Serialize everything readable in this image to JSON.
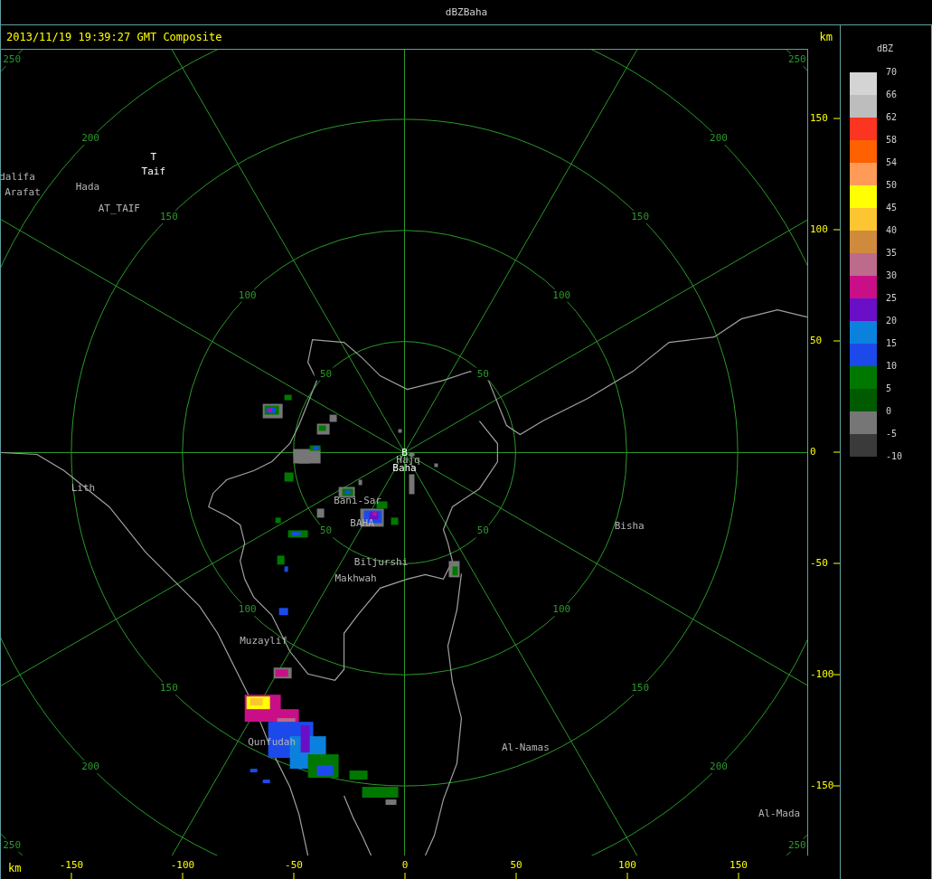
{
  "window": {
    "title": "dBZBaha"
  },
  "header": {
    "timestamp": "2013/11/19 19:39:27 GMT Composite",
    "unit": "km"
  },
  "range_rings": [
    {
      "labels": [
        "50",
        "50",
        "50",
        "50"
      ]
    },
    {
      "labels": [
        "100",
        "100",
        "100",
        "100"
      ]
    },
    {
      "labels": [
        "150",
        "150",
        "150",
        "150"
      ]
    },
    {
      "labels": [
        "200",
        "200",
        "200",
        "200"
      ]
    },
    {
      "labels": [
        "250",
        "250",
        "250",
        "250"
      ]
    }
  ],
  "places": [
    {
      "kind": "site",
      "name": "T"
    },
    {
      "kind": "site",
      "name": "Taif"
    },
    {
      "kind": "town",
      "name": "dalifa"
    },
    {
      "kind": "town",
      "name": "Arafat"
    },
    {
      "kind": "town",
      "name": "Hada"
    },
    {
      "kind": "town",
      "name": "AT_TAIF"
    },
    {
      "kind": "town",
      "name": "Lith"
    },
    {
      "kind": "site",
      "name": "B"
    },
    {
      "kind": "town",
      "name": "Hajq"
    },
    {
      "kind": "site",
      "name": "Baha"
    },
    {
      "kind": "town",
      "name": "Bani-Sar"
    },
    {
      "kind": "town",
      "name": "BAHA"
    },
    {
      "kind": "town",
      "name": "Biljurshi"
    },
    {
      "kind": "town",
      "name": "Makhwah"
    },
    {
      "kind": "town",
      "name": "Bisha"
    },
    {
      "kind": "town",
      "name": "Muzaylif"
    },
    {
      "kind": "town",
      "name": "Qunfudah"
    },
    {
      "kind": "town",
      "name": "Al-Namas"
    },
    {
      "kind": "town",
      "name": "Al-Mada"
    }
  ],
  "y_axis": {
    "ticks": [
      "150",
      "100",
      "50",
      "0",
      "-50",
      "-100",
      "-150"
    ]
  },
  "x_axis": {
    "unit": "km",
    "ticks": [
      "-150",
      "-100",
      "-50",
      "0",
      "50",
      "100",
      "150"
    ]
  },
  "legend": {
    "title": "dBZ",
    "bands": [
      {
        "label": "70",
        "color": "#d4d4d4"
      },
      {
        "label": "66",
        "color": "#bdbdbd"
      },
      {
        "label": "62",
        "color": "#fc3522"
      },
      {
        "label": "58",
        "color": "#ff6000"
      },
      {
        "label": "54",
        "color": "#ff9a58"
      },
      {
        "label": "50",
        "color": "#ffff00"
      },
      {
        "label": "45",
        "color": "#fcc531"
      },
      {
        "label": "40",
        "color": "#d08a3c"
      },
      {
        "label": "35",
        "color": "#bd6b8a"
      },
      {
        "label": "30",
        "color": "#c90f87"
      },
      {
        "label": "25",
        "color": "#6a0fc8"
      },
      {
        "label": "20",
        "color": "#0a82dd"
      },
      {
        "label": "15",
        "color": "#1c4aea"
      },
      {
        "label": "10",
        "color": "#007800"
      },
      {
        "label": "5",
        "color": "#005a00"
      },
      {
        "label": "0",
        "color": "#767676"
      },
      {
        "label": "-5",
        "color": "#3a3a3a"
      }
    ],
    "bottom_label": "-10"
  }
}
